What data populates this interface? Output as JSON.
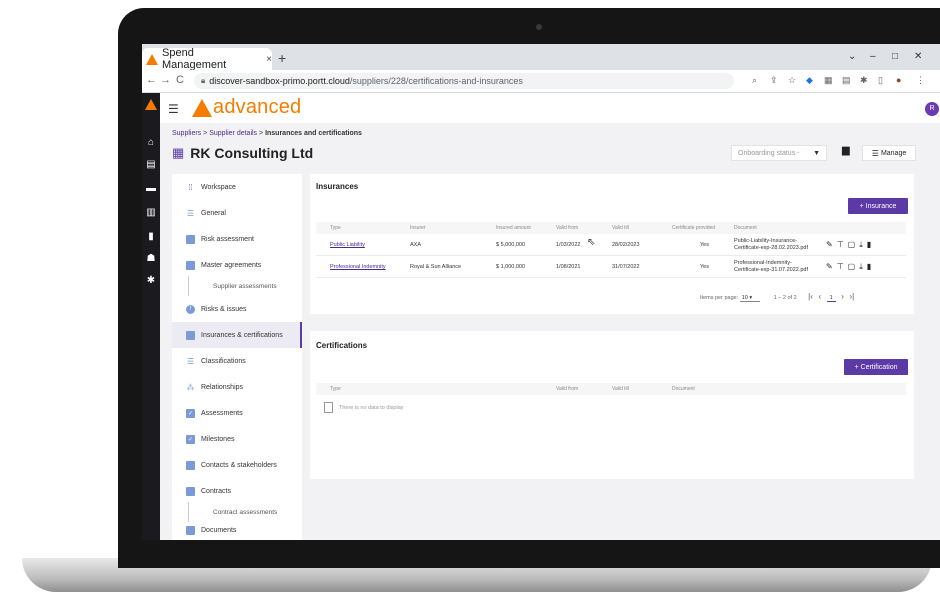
{
  "browser": {
    "tab_title": "Spend Management",
    "tab_close": "×",
    "new_tab": "+",
    "url_host": "discover-sandbox-primo.portt.cloud",
    "url_path": "/suppliers/228/certifications-and-insurances",
    "window_controls": [
      "⌄",
      "–",
      "□",
      "✕"
    ],
    "nav_back": "←",
    "nav_forward": "→",
    "nav_reload": "C"
  },
  "brand": {
    "name": "advanced",
    "color": "#f57c00",
    "accent": "#5b3aa6"
  },
  "user": {
    "initial": "R"
  },
  "breadcrumb": {
    "items": [
      "Suppliers",
      "Supplier details",
      "Insurances and certifications"
    ],
    "sep": ">"
  },
  "page": {
    "title": "RK Consulting Ltd",
    "onboarding_placeholder": "Onboarding status  -",
    "manage_label": "Manage"
  },
  "sidebar": {
    "items": [
      {
        "label": "Workspace",
        "icon": "grid-icon"
      },
      {
        "label": "General",
        "icon": "list-icon"
      },
      {
        "label": "Risk assessment",
        "icon": "doc-icon"
      },
      {
        "label": "Master agreements",
        "icon": "doc-icon"
      },
      {
        "label": "Supplier assessments",
        "icon": "",
        "sub": true
      },
      {
        "label": "Risks & issues",
        "icon": "alert-icon"
      },
      {
        "label": "Insurances & certifications",
        "icon": "certificate-icon",
        "active": true
      },
      {
        "label": "Classifications",
        "icon": "list-icon"
      },
      {
        "label": "Relationships",
        "icon": "relationship-icon"
      },
      {
        "label": "Assessments",
        "icon": "check-icon"
      },
      {
        "label": "Milestones",
        "icon": "check-icon"
      },
      {
        "label": "Contacts & stakeholders",
        "icon": "contact-icon"
      },
      {
        "label": "Contracts",
        "icon": "doc-icon"
      },
      {
        "label": "Contract assessments",
        "icon": "",
        "sub": true
      },
      {
        "label": "Documents",
        "icon": "doc-icon"
      }
    ]
  },
  "insurances": {
    "title": "Insurances",
    "add_label": "+ Insurance",
    "columns": [
      "Type",
      "Insurer",
      "Insured amount",
      "Valid from",
      "Valid till",
      "Certificate provided",
      "Document"
    ],
    "rows": [
      {
        "type": "Public Liability",
        "insurer": "AXA",
        "amount": "$ 5,000,000",
        "from": "1/03/2022",
        "till": "28/02/2023",
        "provided": "Yes",
        "doc1": "Public-Liability-Insurance-",
        "doc2": "Certificate-exp-28.02.2023.pdf"
      },
      {
        "type": "Professional Indemnity",
        "insurer": "Royal & Sun Alliance",
        "amount": "$ 1,000,000",
        "from": "1/08/2021",
        "till": "31/07/2022",
        "provided": "Yes",
        "doc1": "Professional-Indemnity-",
        "doc2": "Certificate-exp-31.07.2022.pdf"
      }
    ],
    "pager": {
      "items_per_page_label": "Items per page:",
      "per_page": "10",
      "range": "1 – 2 of 2",
      "page": "1"
    }
  },
  "certifications": {
    "title": "Certifications",
    "add_label": "+ Certification",
    "columns": [
      "Type",
      "Valid from",
      "Valid till",
      "Document"
    ],
    "empty_text": "There is no data to display"
  }
}
